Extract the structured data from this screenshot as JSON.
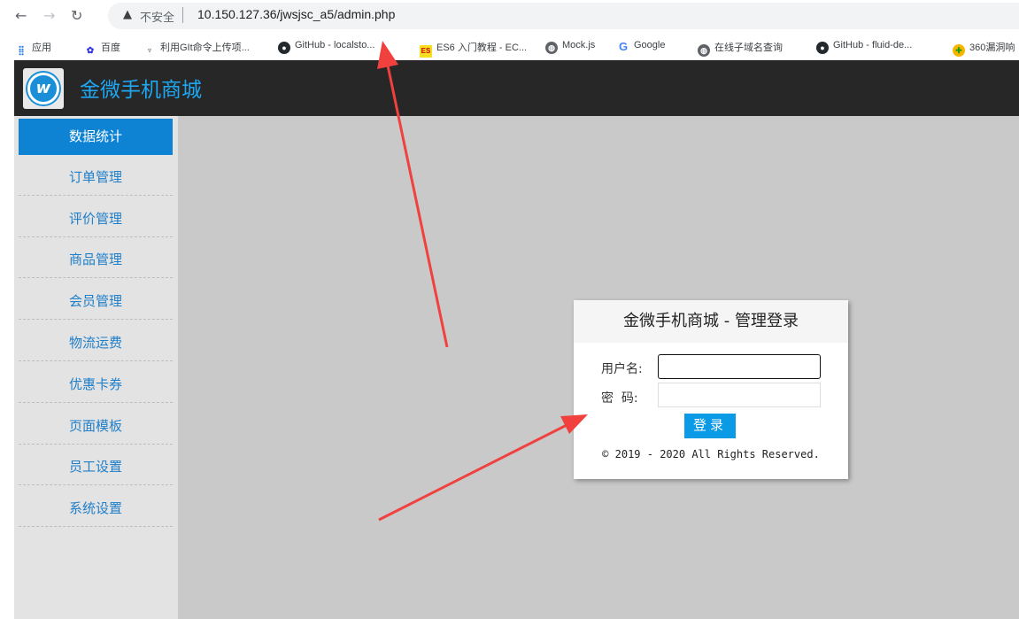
{
  "browser": {
    "security_label": "不安全",
    "url": "10.150.127.36/jwsjsc_a5/admin.php",
    "bookmarks": [
      {
        "label": "应用",
        "icon": "apps-grid-icon"
      },
      {
        "label": "百度",
        "icon": "baidu-paw-icon"
      },
      {
        "label": "利用GIt命令上传项...",
        "icon": "git-icon"
      },
      {
        "label": "GitHub - localsto...",
        "icon": "github-icon"
      },
      {
        "label": "ES6 入门教程 - EC...",
        "icon": "es-icon"
      },
      {
        "label": "Mock.js",
        "icon": "globe-icon"
      },
      {
        "label": "Google",
        "icon": "google-icon"
      },
      {
        "label": "在线子域名查询",
        "icon": "globe-icon"
      },
      {
        "label": "GitHub - fluid-de...",
        "icon": "github-icon"
      },
      {
        "label": "360漏洞响",
        "icon": "360-icon"
      }
    ]
  },
  "header": {
    "site_title": "金微手机商城",
    "logo_icon": "jinwei-logo-icon"
  },
  "sidebar": {
    "items": [
      {
        "label": "数据统计",
        "active": true
      },
      {
        "label": "订单管理",
        "active": false
      },
      {
        "label": "评价管理",
        "active": false
      },
      {
        "label": "商品管理",
        "active": false
      },
      {
        "label": "会员管理",
        "active": false
      },
      {
        "label": "物流运费",
        "active": false
      },
      {
        "label": "优惠卡券",
        "active": false
      },
      {
        "label": "页面模板",
        "active": false
      },
      {
        "label": "员工设置",
        "active": false
      },
      {
        "label": "系统设置",
        "active": false
      }
    ]
  },
  "login": {
    "title": "金微手机商城 - 管理登录",
    "username_label": "用户名:",
    "username_value": "",
    "password_label": "密  码:",
    "password_value": "",
    "submit_label": "登录",
    "copyright": "© 2019 - 2020 All Rights Reserved."
  },
  "colors": {
    "accent": "#1ea7f2",
    "active_menu": "#0e83d4",
    "arrow": "#f0413f"
  }
}
